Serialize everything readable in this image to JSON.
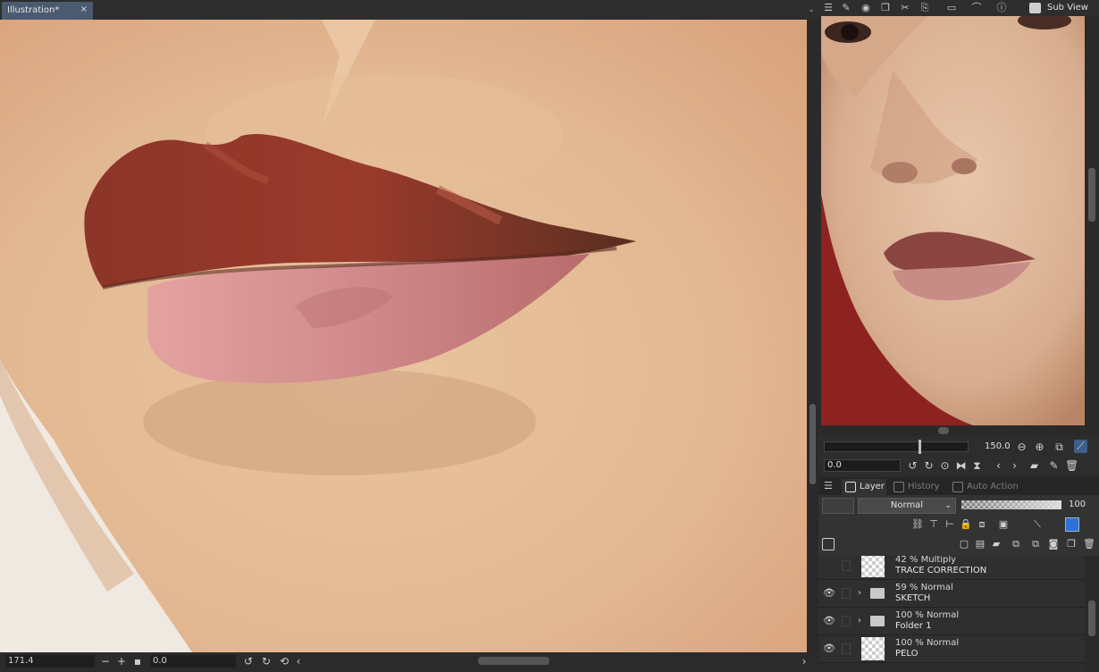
{
  "document": {
    "tab_title": "Illustration*",
    "close_glyph": "×"
  },
  "statusbar": {
    "zoom_value": "171.4",
    "zoom_out_glyph": "−",
    "zoom_in_glyph": "+",
    "rotation_value": "0.0"
  },
  "subview": {
    "label": "Sub View",
    "zoom_value": "150.0",
    "rotation_value": "0.0"
  },
  "layer_panel": {
    "tabs": [
      {
        "label": "Layer",
        "icon": "layer-icon"
      },
      {
        "label": "History",
        "icon": "history-icon"
      },
      {
        "label": "Auto Action",
        "icon": "auto-action-icon"
      }
    ],
    "blend_mode": "Normal",
    "opacity": "100",
    "opacity_fraction": 1.0,
    "accent_color": "#2e6fd8",
    "layers": [
      {
        "mode": "42 % Multiply",
        "name": "TRACE CORRECTION",
        "type": "raster",
        "visible": false
      },
      {
        "mode": "59 % Normal",
        "name": "SKETCH",
        "type": "folder",
        "visible": true
      },
      {
        "mode": "100 % Normal",
        "name": "Folder 1",
        "type": "folder",
        "visible": true
      },
      {
        "mode": "100 % Normal",
        "name": "PELO",
        "type": "raster",
        "visible": true
      }
    ]
  }
}
